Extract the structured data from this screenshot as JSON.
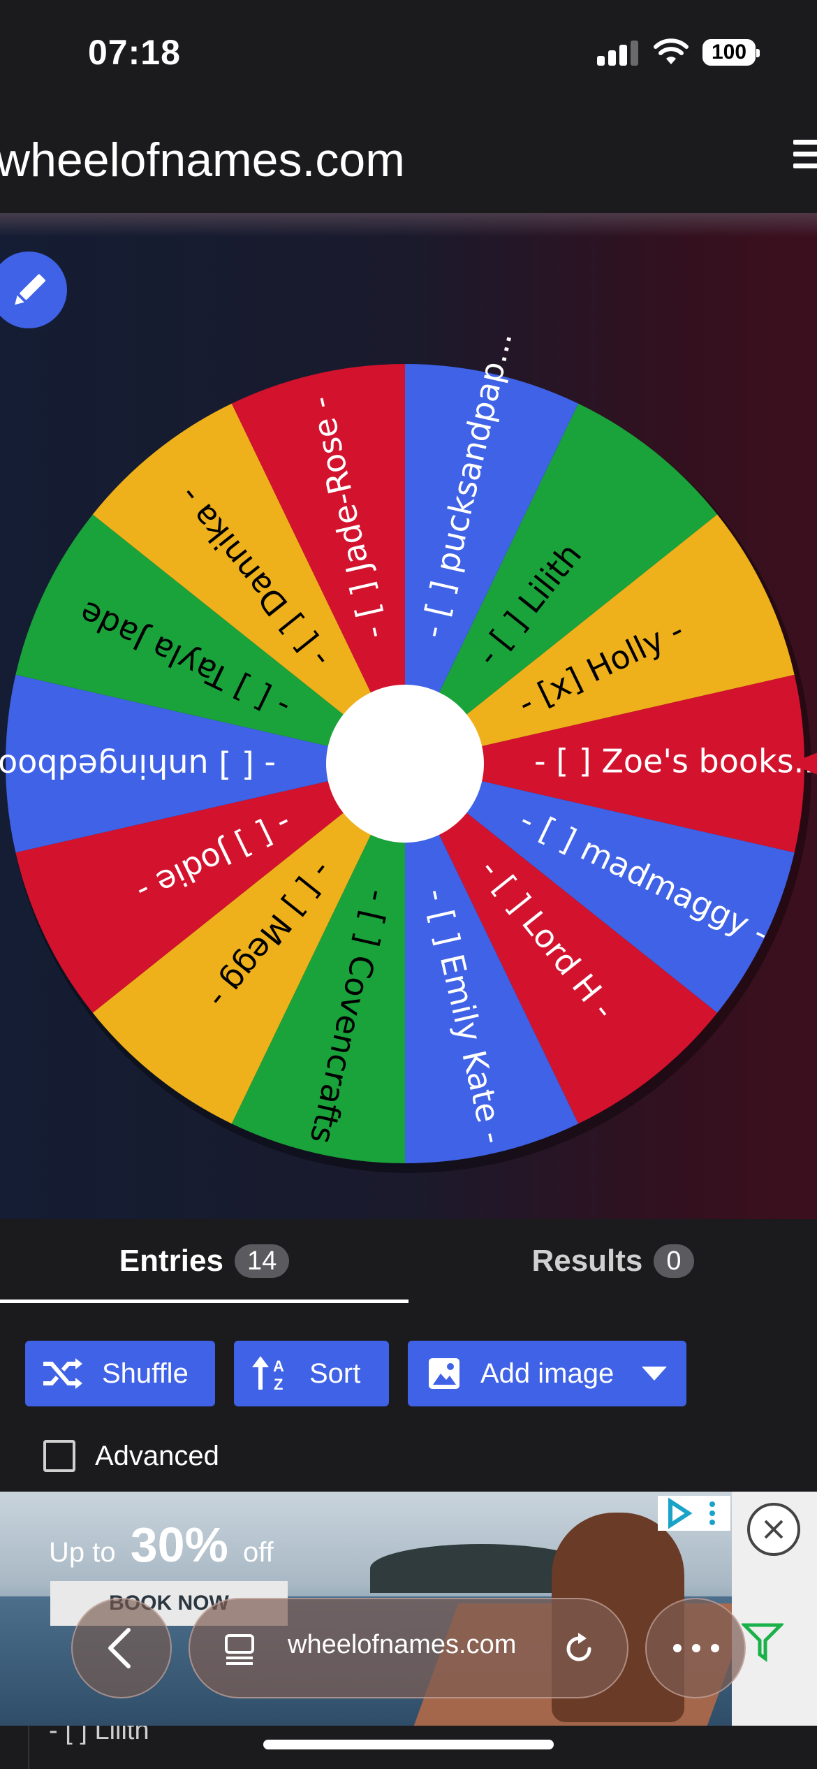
{
  "status_bar": {
    "time": "07:18",
    "battery": "100"
  },
  "header": {
    "site": "wheelofnames.com"
  },
  "wheel": {
    "colors": [
      "#3f62e6",
      "#1aa33a",
      "#efb11b",
      "#d3122e"
    ],
    "pointer_color": "#d3122e",
    "entries": [
      "- [ ] Zoe's books...",
      "- [ ] madmaggy -",
      "- [ ] Lord H -",
      "- [ ] Emily Kate -",
      "- [ ] Covencrafts",
      "- [ ] Megg -",
      "- [ ] Jodie -",
      "- [ ] unhingedboo...",
      "- [ ] Tayla Jade",
      "- [ ] Dannika -",
      "- [ ] Jade-Rose -",
      "- [ ] pucksandpap...",
      "- [ ] Lilith",
      "- [x] Holly -"
    ]
  },
  "tabs": {
    "entries_label": "Entries",
    "entries_count": "14",
    "results_label": "Results",
    "results_count": "0"
  },
  "toolbar": {
    "shuffle_label": "Shuffle",
    "sort_label": "Sort",
    "add_image_label": "Add image",
    "advanced_label": "Advanced"
  },
  "ad": {
    "upto_prefix": "Up to",
    "upto_value": "30%",
    "upto_suffix": "off",
    "cta": "BOOK NOW"
  },
  "browser": {
    "url": "wheelofnames.com"
  },
  "list_peek": {
    "first_visible": "- [ ] Lilith"
  }
}
